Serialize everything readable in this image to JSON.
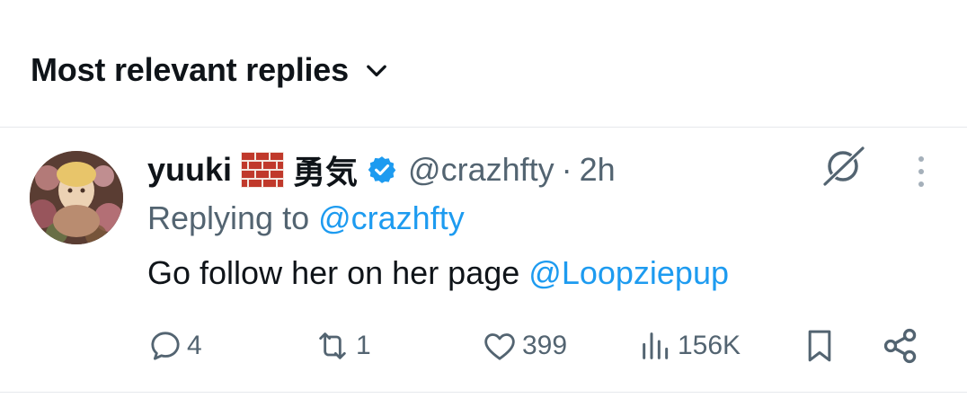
{
  "header": {
    "sort_label": "Most relevant replies",
    "chevron_icon": "chevron-down-icon"
  },
  "reply": {
    "display_name": "yuuki",
    "name_emoji_icon": "brick-emoji",
    "name_kanji": "勇気",
    "verified_icon": "verified-badge-icon",
    "handle": "@crazhfty",
    "separator": "·",
    "timestamp": "2h",
    "replying_prefix": "Replying to",
    "replying_to": "@crazhfty",
    "text": "Go follow her on her page",
    "text_mention": "@Loopziepup",
    "grok_icon": "grok-icon",
    "more_icon": "more-vertical-icon"
  },
  "actions": {
    "reply_count": "4",
    "repost_count": "1",
    "like_count": "399",
    "view_count": "156K"
  },
  "colors": {
    "accent": "#1d9bf0",
    "secondary_text": "#536471",
    "primary_text": "#0f1419",
    "divider": "#e6e9ec"
  }
}
